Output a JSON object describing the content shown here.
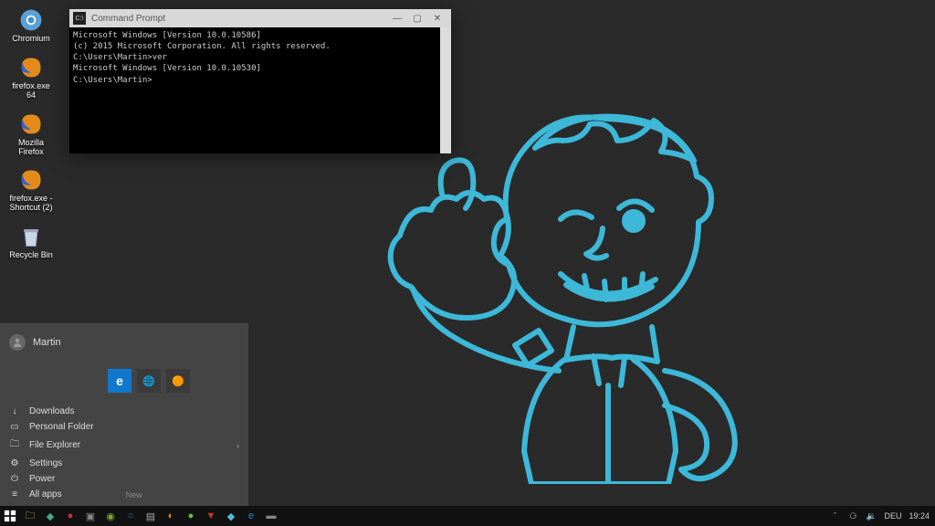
{
  "desktop": {
    "icons": [
      {
        "name": "chromium",
        "label": "Chromium"
      },
      {
        "name": "firefox64",
        "label": "firefox.exe 64"
      },
      {
        "name": "firefox",
        "label": "Mozilla Firefox"
      },
      {
        "name": "ffshort",
        "label": "firefox.exe - Shortcut (2)"
      },
      {
        "name": "recycle",
        "label": "Recycle Bin"
      }
    ]
  },
  "cmd": {
    "title": "Command Prompt",
    "lines": [
      "Microsoft Windows [Version 10.0.10586]",
      "(c) 2015 Microsoft Corporation. All rights reserved.",
      "",
      "C:\\Users\\Martin>ver",
      "",
      "Microsoft Windows [Version 10.0.10530]",
      "",
      "C:\\Users\\Martin>"
    ]
  },
  "startmenu": {
    "user": "Martin",
    "tiles": [
      "Edge",
      "Globe",
      "App"
    ],
    "items": [
      {
        "icon": "↓",
        "label": "Downloads"
      },
      {
        "icon": "▭",
        "label": "Personal Folder"
      },
      {
        "icon": "🗀",
        "label": "File Explorer",
        "arrow": "›"
      },
      {
        "icon": "⚙",
        "label": "Settings"
      },
      {
        "icon": "⏻",
        "label": "Power"
      },
      {
        "icon": "≡",
        "label": "All apps",
        "new": "New"
      }
    ]
  },
  "taskbar": {
    "tray": {
      "lang": "DEU",
      "time": "19:24"
    }
  }
}
